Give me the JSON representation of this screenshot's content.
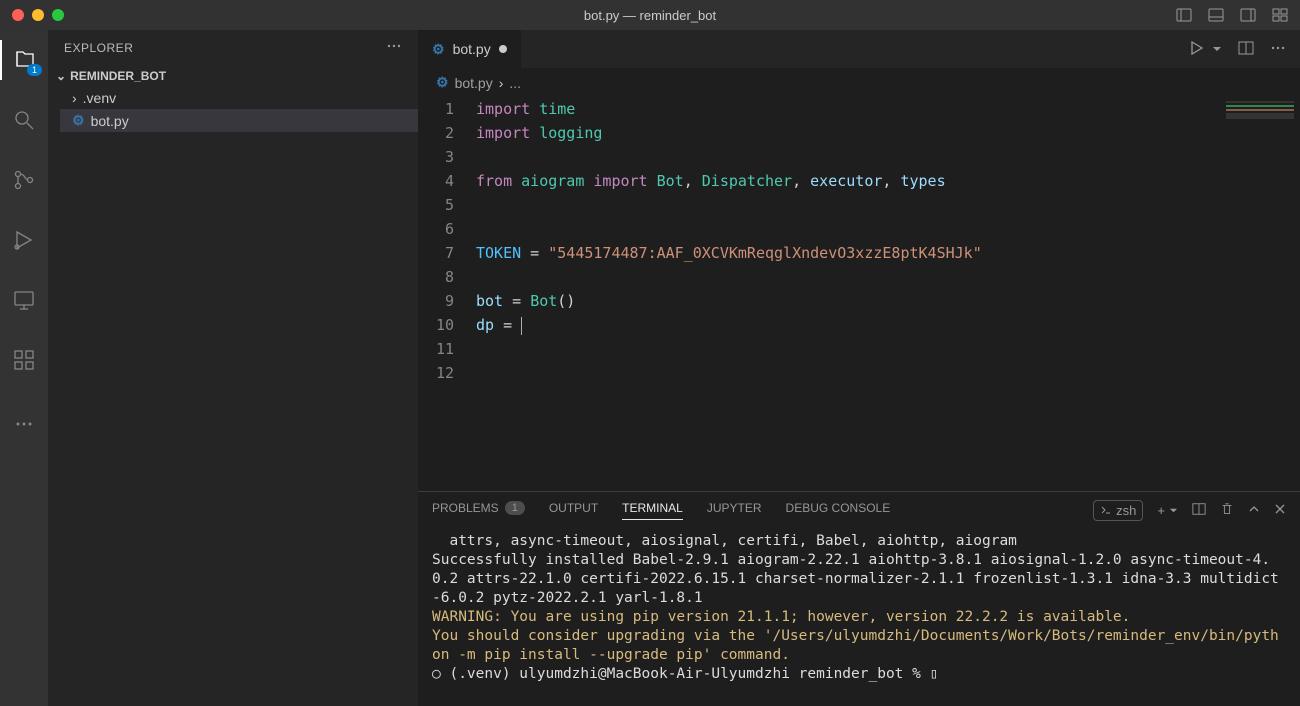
{
  "title": "bot.py — reminder_bot",
  "explorer": {
    "label": "EXPLORER",
    "root": "REMINDER_BOT",
    "items": [
      {
        "label": ".venv",
        "kind": "folder"
      },
      {
        "label": "bot.py",
        "kind": "file"
      }
    ]
  },
  "activityBadge": "1",
  "tab": {
    "name": "bot.py",
    "modified": true
  },
  "breadcrumb": {
    "file": "bot.py",
    "trail": "..."
  },
  "code": {
    "lines": [
      {
        "n": "1",
        "t": [
          [
            "kw",
            "import "
          ],
          [
            "mod",
            "time"
          ]
        ]
      },
      {
        "n": "2",
        "t": [
          [
            "kw",
            "import "
          ],
          [
            "mod",
            "logging"
          ]
        ]
      },
      {
        "n": "3",
        "t": []
      },
      {
        "n": "4",
        "t": [
          [
            "kw",
            "from "
          ],
          [
            "mod",
            "aiogram "
          ],
          [
            "kw",
            "import "
          ],
          [
            "cls",
            "Bot"
          ],
          [
            "punc",
            ", "
          ],
          [
            "cls",
            "Dispatcher"
          ],
          [
            "punc",
            ", "
          ],
          [
            "var",
            "executor"
          ],
          [
            "punc",
            ", "
          ],
          [
            "var",
            "types"
          ]
        ]
      },
      {
        "n": "5",
        "t": []
      },
      {
        "n": "6",
        "t": []
      },
      {
        "n": "7",
        "t": [
          [
            "const",
            "TOKEN"
          ],
          [
            "punc",
            " = "
          ],
          [
            "str",
            "\"5445174487:AAF_0XCVKmReqglXndevO3xzzE8ptK4SHJk\""
          ]
        ]
      },
      {
        "n": "8",
        "t": []
      },
      {
        "n": "9",
        "t": [
          [
            "var",
            "bot"
          ],
          [
            "punc",
            " = "
          ],
          [
            "cls",
            "Bot"
          ],
          [
            "punc",
            "()"
          ]
        ]
      },
      {
        "n": "10",
        "t": [
          [
            "var",
            "dp"
          ],
          [
            "punc",
            " = "
          ]
        ],
        "cursor": true
      },
      {
        "n": "11",
        "t": []
      },
      {
        "n": "12",
        "t": []
      }
    ]
  },
  "panel": {
    "tabs": {
      "problems": "PROBLEMS",
      "problemsCount": "1",
      "output": "OUTPUT",
      "terminal": "TERMINAL",
      "jupyter": "JUPYTER",
      "debug": "DEBUG CONSOLE"
    },
    "shell": "zsh",
    "lines": [
      {
        "cls": "term-white",
        "text": "  attrs, async-timeout, aiosignal, certifi, Babel, aiohttp, aiogram"
      },
      {
        "cls": "term-white",
        "text": "Successfully installed Babel-2.9.1 aiogram-2.22.1 aiohttp-3.8.1 aiosignal-1.2.0 async-timeout-4.0.2 attrs-22.1.0 certifi-2022.6.15.1 charset-normalizer-2.1.1 frozenlist-1.3.1 idna-3.3 multidict-6.0.2 pytz-2022.2.1 yarl-1.8.1"
      },
      {
        "cls": "term-yellow",
        "text": "WARNING: You are using pip version 21.1.1; however, version 22.2.2 is available."
      },
      {
        "cls": "term-yellow",
        "text": "You should consider upgrading via the '/Users/ulyumdzhi/Documents/Work/Bots/reminder_env/bin/python -m pip install --upgrade pip' command."
      },
      {
        "cls": "term-prompt",
        "text": "○ (.venv) ulyumdzhi@MacBook-Air-Ulyumdzhi reminder_bot % ▯"
      }
    ]
  }
}
